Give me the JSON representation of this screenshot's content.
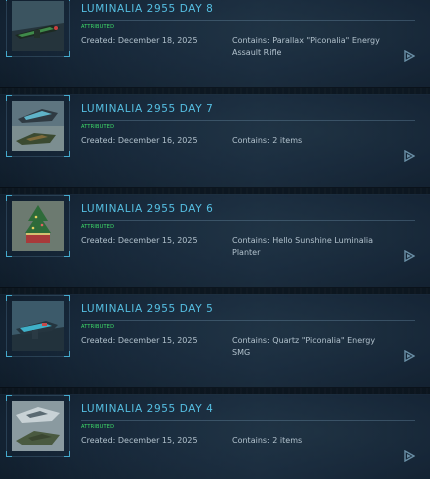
{
  "items": [
    {
      "title": "LUMINALIA 2955 DAY 8",
      "badge": "ATTRIBUTED",
      "created": "Created: December 18, 2025",
      "contains": "Contains: Parallax \"Piconalia\" Energy Assault Rifle",
      "thumb_icon": "rifle-thumbnail-icon"
    },
    {
      "title": "LUMINALIA 2955 DAY 7",
      "badge": "ATTRIBUTED",
      "created": "Created: December 16, 2025",
      "contains": "Contains: 2 items",
      "thumb_icon": "vehicle-thumbnail-icon"
    },
    {
      "title": "LUMINALIA 2955 DAY 6",
      "badge": "ATTRIBUTED",
      "created": "Created: December 15, 2025",
      "contains": "Contains: Hello Sunshine Luminalia Planter",
      "thumb_icon": "planter-thumbnail-icon"
    },
    {
      "title": "LUMINALIA 2955 DAY 5",
      "badge": "ATTRIBUTED",
      "created": "Created: December 15, 2025",
      "contains": "Contains: Quartz \"Piconalia\" Energy SMG",
      "thumb_icon": "smg-thumbnail-icon"
    },
    {
      "title": "LUMINALIA 2955 DAY 4",
      "badge": "ATTRIBUTED",
      "created": "Created: December 15, 2025",
      "contains": "Contains: 2 items",
      "thumb_icon": "ship-thumbnail-icon"
    }
  ],
  "colors": {
    "title": "#55bfe2",
    "badge": "#3fe06a",
    "text": "#b2c2cd",
    "accent": "#45aacd"
  }
}
